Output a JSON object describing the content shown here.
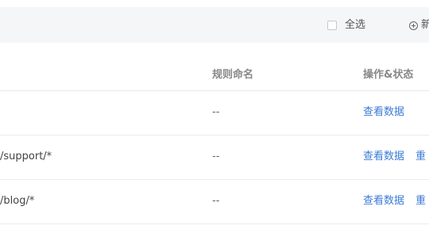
{
  "toolbar": {
    "select_all_label": "全选",
    "add_label": "新"
  },
  "table": {
    "columns": [
      "规则命名",
      "操作&状态"
    ],
    "rows": [
      {
        "path": "",
        "name": "--",
        "actions": [
          "查看数据"
        ]
      },
      {
        "path": "/support/*",
        "name": "--",
        "actions": [
          "查看数据",
          "重"
        ]
      },
      {
        "path": "/blog/*",
        "name": "--",
        "actions": [
          "查看数据",
          "重"
        ]
      }
    ]
  },
  "colors": {
    "link": "#3b7bd6",
    "toolbar_bg": "#f5f6f8",
    "header_text": "#888888"
  }
}
